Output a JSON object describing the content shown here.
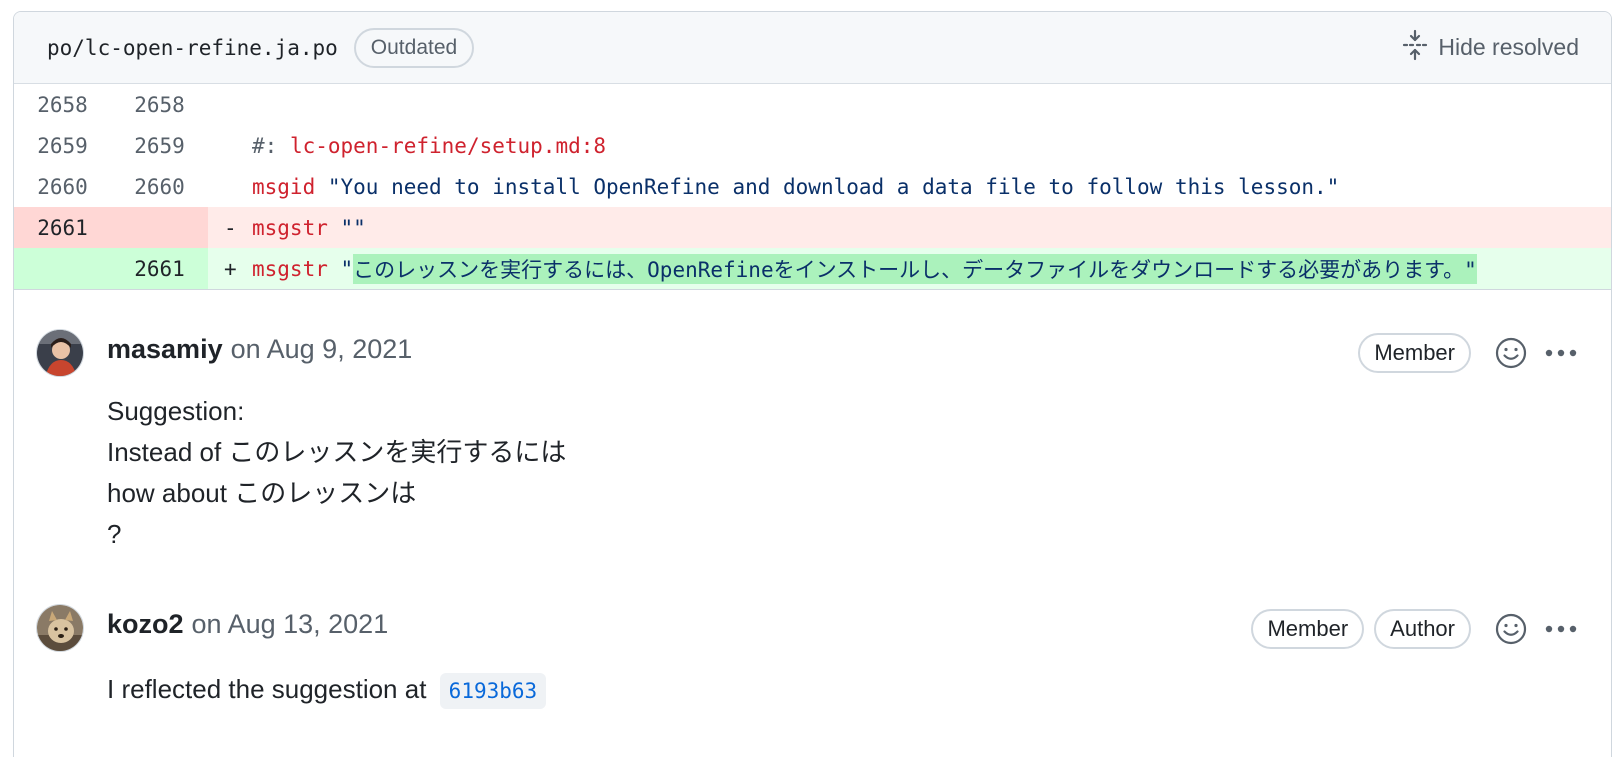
{
  "file": {
    "path": "po/lc-open-refine.ja.po",
    "outdated_label": "Outdated",
    "hide_resolved_label": "Hide resolved"
  },
  "diff": {
    "rows": [
      {
        "old": "2658",
        "new": "2658",
        "marker": " ",
        "code": ""
      },
      {
        "old": "2659",
        "new": "2659",
        "marker": " ",
        "prefix": "#: ",
        "keyword": "lc-open-refine/setup.md:8"
      },
      {
        "old": "2660",
        "new": "2660",
        "marker": " ",
        "keyword": "msgid",
        "string": " \"You need to install OpenRefine and download a data file to follow this lesson.\""
      },
      {
        "old": "2661",
        "new": "",
        "marker": "-",
        "keyword": "msgstr",
        "string": " \"\""
      },
      {
        "old": "",
        "new": "2661",
        "marker": "+",
        "keyword": "msgstr",
        "string": " \"",
        "highlight": "このレッスンを実行するには、OpenRefineをインストールし、データファイルをダウンロードする必要があります。\""
      }
    ]
  },
  "comments": [
    {
      "author": "masamiy",
      "date": "on Aug 9, 2021",
      "badges": [
        "Member"
      ],
      "body": [
        "Suggestion:",
        "Instead of このレッスンを実行するには",
        "how about このレッスンは",
        "?"
      ]
    },
    {
      "author": "kozo2",
      "date": "on Aug 13, 2021",
      "badges": [
        "Member",
        "Author"
      ],
      "body_text": "I reflected the suggestion at",
      "commit": "6193b63"
    }
  ],
  "icons": {
    "hide_resolved": "fold-icon",
    "reaction": "smiley-icon",
    "more": "kebab-horizontal-icon"
  },
  "colors": {
    "deleted_line": "#ffebe9",
    "added_line": "#e6ffec",
    "added_highlight": "#abf2bc",
    "keyword": "#cf222e",
    "string": "#0a3069",
    "link": "#0969da"
  }
}
